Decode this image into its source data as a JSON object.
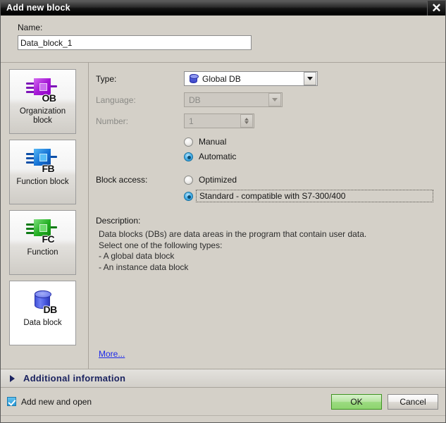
{
  "dialog": {
    "title": "Add new block",
    "close_icon": "close-icon"
  },
  "name_section": {
    "label": "Name:",
    "value": "Data_block_1",
    "placeholder": ""
  },
  "block_types": [
    {
      "id": "organization-block",
      "caption": "Organization\nblock",
      "tag": "OB",
      "selected": false
    },
    {
      "id": "function-block",
      "caption": "Function block",
      "tag": "FB",
      "selected": false
    },
    {
      "id": "function",
      "caption": "Function",
      "tag": "FC",
      "selected": false
    },
    {
      "id": "data-block",
      "caption": "Data block",
      "tag": "DB",
      "selected": true
    }
  ],
  "form": {
    "type": {
      "label": "Type:",
      "value": "Global DB",
      "icon": "database-cylinder-icon",
      "enabled": true
    },
    "language": {
      "label": "Language:",
      "value": "DB",
      "enabled": false
    },
    "number": {
      "label": "Number:",
      "value": "1",
      "enabled": false
    },
    "number_mode": {
      "options": [
        {
          "label": "Manual",
          "checked": false
        },
        {
          "label": "Automatic",
          "checked": true
        }
      ]
    },
    "block_access": {
      "label": "Block access:",
      "options": [
        {
          "label": "Optimized",
          "checked": false,
          "focused": false
        },
        {
          "label": "Standard - compatible with S7-300/400",
          "checked": true,
          "focused": true
        }
      ]
    },
    "description": {
      "label": "Description:",
      "text": "Data blocks (DBs) are data areas in the program that contain user data.\nSelect one of the following types:\n- A global data block\n- An instance data block"
    },
    "more_link": "More..."
  },
  "additional_information": {
    "label": "Additional  information",
    "expander_icon": "chevron-right-icon",
    "expanded": false
  },
  "footer": {
    "checkbox": {
      "label": "Add new and open",
      "checked": true
    },
    "ok_label": "OK",
    "cancel_label": "Cancel"
  },
  "colors": {
    "dialog_bg": "#d4d0c8",
    "titlebar": "#000000",
    "ok_green": "#8ed46f",
    "link_blue": "#1d2aea",
    "accent_navy": "#1b2360",
    "radio_blue": "#2b9bd8"
  }
}
